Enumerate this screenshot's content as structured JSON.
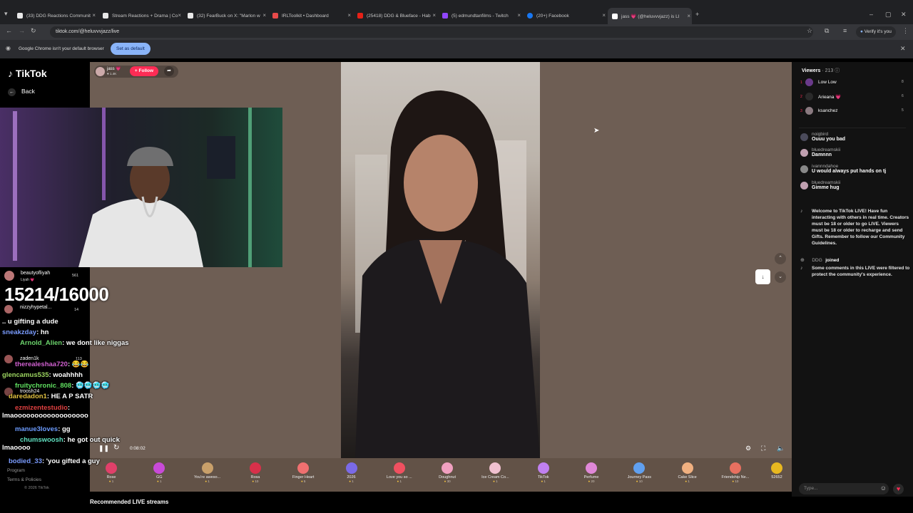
{
  "browser": {
    "tabs": [
      {
        "title": "(33) DDG Reactions Communit",
        "color": "#e8e8e8"
      },
      {
        "title": "Stream Reactions + Drama | Co",
        "color": "#e8e8e8"
      },
      {
        "title": "(32) FearBuck on X: \"Marlon w",
        "color": "#e8e8e8"
      },
      {
        "title": "IRLToolkit • Dashboard",
        "color": "#e84a4a"
      },
      {
        "title": "(25418) DDG & Blueface - Hab",
        "color": "#e62117"
      },
      {
        "title": "(5) edmundtanfilms - Twitch",
        "color": "#9146ff"
      },
      {
        "title": "(20+) Facebook",
        "color": "#1877f2"
      },
      {
        "title": "jass 💗 (@heluvvvjazz) is LI",
        "color": "#ffffff"
      }
    ],
    "url": "tiktok.com/@heluvvvjazz/live",
    "verify_label": "Verify it's you",
    "infobar_text": "Google Chrome isn't your default browser",
    "set_default_label": "Set as default"
  },
  "tiktok": {
    "logo": "TikTok",
    "back_label": "Back",
    "footer_links": [
      "Program",
      "Terms & Policies",
      "© 2026 TikTok"
    ],
    "recommended_label": "Recommended LIVE streams",
    "host": {
      "name": "jass 💗",
      "likes": "1.4K",
      "follow_label": "+ Follow"
    },
    "playback_time": "0:08:02",
    "gifts": [
      {
        "name": "Rose",
        "cost": "1",
        "color": "#e0406a"
      },
      {
        "name": "GG",
        "cost": "1",
        "color": "#c84ad8"
      },
      {
        "name": "You're aweso...",
        "cost": "1",
        "color": "#c9a06a"
      },
      {
        "name": "Rosa",
        "cost": "10",
        "color": "#d8304a"
      },
      {
        "name": "Finger Heart",
        "cost": "5",
        "color": "#f07070"
      },
      {
        "name": "2026",
        "cost": "1",
        "color": "#7a6ae8"
      },
      {
        "name": "Love you so ...",
        "cost": "1",
        "color": "#f05060"
      },
      {
        "name": "Doughnut",
        "cost": "30",
        "color": "#f0a0c0"
      },
      {
        "name": "Ice Cream Co...",
        "cost": "1",
        "color": "#f0c0d0"
      },
      {
        "name": "TikTok",
        "cost": "1",
        "color": "#c080f0"
      },
      {
        "name": "Perfume",
        "cost": "20",
        "color": "#e088d8"
      },
      {
        "name": "Journey Pass",
        "cost": "10",
        "color": "#60a0f0"
      },
      {
        "name": "Cake Slice",
        "cost": "1",
        "color": "#f0b080"
      },
      {
        "name": "Friendship Ne...",
        "cost": "10",
        "color": "#e87060"
      }
    ],
    "coins": "52652",
    "viewers": {
      "label": "Viewers",
      "count": "213",
      "top": [
        {
          "rank": "1",
          "name": "Low Low",
          "score": "8"
        },
        {
          "rank": "2",
          "name": "Arieana 💗",
          "score": "6"
        },
        {
          "rank": "3",
          "name": "ksanchez",
          "score": "5"
        }
      ]
    },
    "comments": [
      {
        "user": "noigbird",
        "text": "Ouuu you bad"
      },
      {
        "user": "bluedreamskii",
        "text": "Damnnn"
      },
      {
        "user": "ivannndahoe",
        "text": "U would always put hands on tj"
      },
      {
        "user": "bluedreamskii",
        "text": "Gimme hug"
      }
    ],
    "system_messages": [
      "Welcome to TikTok LIVE! Have fun interacting with others in real time. Creators must be 18 or older to go LIVE. Viewers must be 18 or older to recharge and send Gifts. Remember to follow our Community Guidelines.",
      "Some comments in this LIVE were filtered to protect the community's experience."
    ],
    "joined": {
      "user": "DDG",
      "text": "joined"
    },
    "chat_placeholder": "Type..."
  },
  "overlay": {
    "counter": "15214/16000",
    "gifters": [
      {
        "name": "beautyofliyah",
        "sub": "Liyah 💗",
        "value": "561"
      },
      {
        "name": "nizzyhypetal...",
        "sub": "",
        "value": "14"
      },
      {
        "name": "zaden1k",
        "sub": "",
        "value": "113"
      },
      {
        "name": "troosh24",
        "sub": "",
        "value": ""
      }
    ],
    "chat": [
      {
        "user": "",
        "text": "u gifting a dude",
        "ucolor": "#ffffff"
      },
      {
        "user": "sneakzday",
        "text": ": hn",
        "ucolor": "#7a9cff"
      },
      {
        "user": "Arnold_Alien",
        "text": ": we dont like niggas",
        "ucolor": "#6cd46c"
      },
      {
        "user": "therealeshaa720",
        "text": ": 😂😂",
        "ucolor": "#d060d0"
      },
      {
        "user": "glencamus535",
        "text": ": woahhhh",
        "ucolor": "#9cd460"
      },
      {
        "user": "fruitychronic_808",
        "text": ": 🥶🥶🥶🥶",
        "ucolor": "#60e060"
      },
      {
        "user": "daredadon1",
        "text": ": HE A P SATR",
        "ucolor": "#e0c040"
      },
      {
        "user": "ezmizentestudio",
        "text": ": lmaoooooooooooooooooo",
        "ucolor": "#e04040"
      },
      {
        "user": "manue3loves",
        "text": ": gg",
        "ucolor": "#6c9cff"
      },
      {
        "user": "chumswoosh",
        "text": ": he got out quick lmaoooo",
        "ucolor": "#60e0c0"
      },
      {
        "user": "bodied_33",
        "text": ": 'you gifted a guy",
        "ucolor": "#7a9cff"
      }
    ]
  }
}
